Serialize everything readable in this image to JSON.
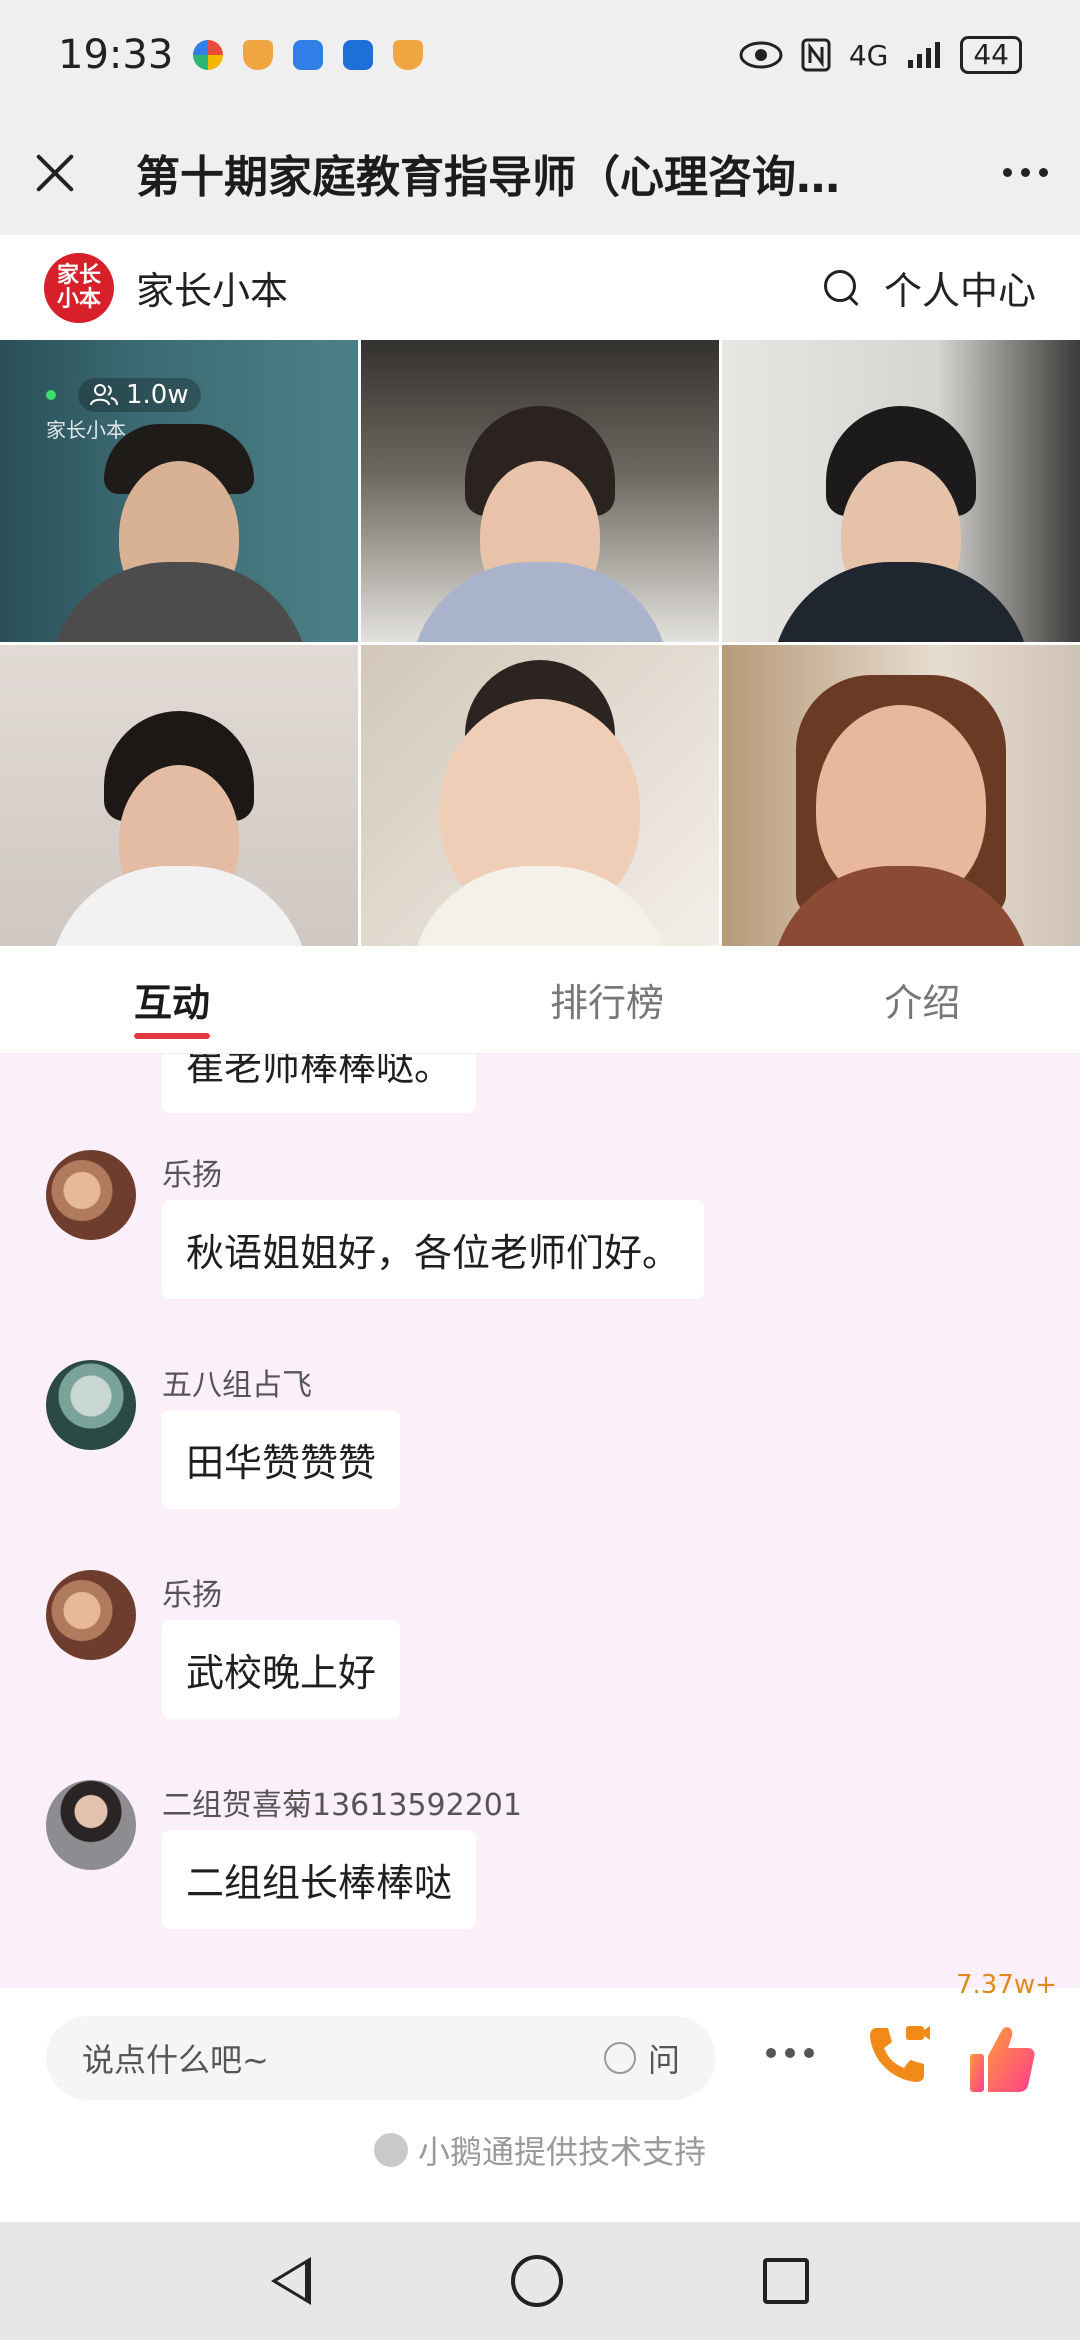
{
  "status": {
    "time": "19:33",
    "network": "4G",
    "battery": "44"
  },
  "header": {
    "title": "第十期家庭教育指导师（心理咨询…"
  },
  "brand": {
    "logo_text": "家长小本",
    "name": "家长小本",
    "personal_center": "个人中心"
  },
  "live": {
    "viewers": "1.0w",
    "watermark": "家长小本"
  },
  "tabs": [
    "互动",
    "排行榜",
    "介绍"
  ],
  "chat": {
    "prev_message": "崔老师棒棒哒。",
    "messages": [
      {
        "user": "乐扬",
        "text": "秋语姐姐好，各位老师们好。",
        "avatar": "hands-avatar"
      },
      {
        "user": "五八组占飞",
        "text": "田华赞赞赞",
        "avatar": "dragon-avatar"
      },
      {
        "user": "乐扬",
        "text": "武校晚上好",
        "avatar": "hands-avatar"
      },
      {
        "user": "二组贺喜菊13613592201",
        "text": "二组组长棒棒哒",
        "avatar": "woman-avatar"
      }
    ]
  },
  "input": {
    "placeholder": "说点什么吧~",
    "ask_label": "问",
    "like_count": "7.37w+"
  },
  "footer": {
    "tech_support": "小鹅通提供技术支持"
  },
  "colors": {
    "accent": "#e23a3f",
    "chat_bg": "#fbf0fa",
    "like_orange": "#e08a1e"
  }
}
